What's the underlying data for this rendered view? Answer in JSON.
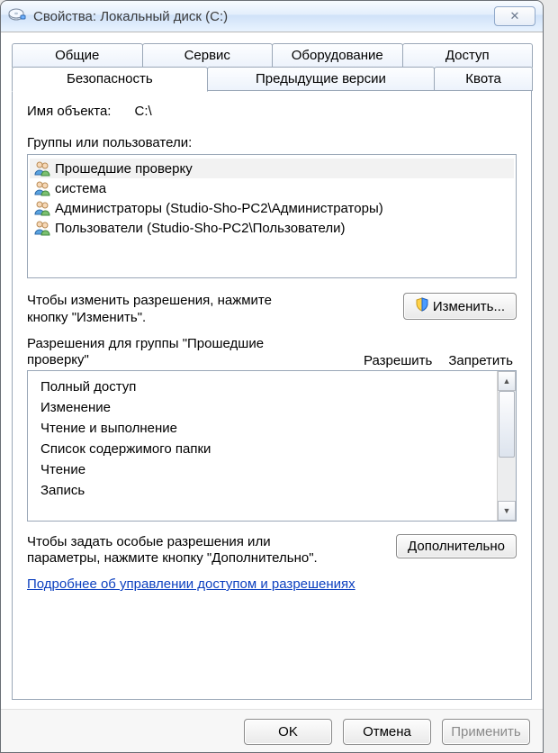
{
  "window": {
    "title": "Свойства: Локальный диск (C:)",
    "close_glyph": "✕"
  },
  "tabs": {
    "row1": [
      {
        "label": "Общие"
      },
      {
        "label": "Сервис"
      },
      {
        "label": "Оборудование"
      },
      {
        "label": "Доступ"
      }
    ],
    "row2": [
      {
        "label": "Безопасность",
        "active": true
      },
      {
        "label": "Предыдущие версии"
      },
      {
        "label": "Квота"
      }
    ]
  },
  "security": {
    "object_name_label": "Имя объекта:",
    "object_name_value": "C:\\",
    "groups_label": "Группы или пользователи:",
    "groups": [
      {
        "label": "Прошедшие проверку",
        "selected": true
      },
      {
        "label": "система"
      },
      {
        "label": "Администраторы (Studio-Sho-PC2\\Администраторы)"
      },
      {
        "label": "Пользователи (Studio-Sho-PC2\\Пользователи)"
      }
    ],
    "edit_hint": "Чтобы изменить разрешения, нажмите кнопку \"Изменить\".",
    "edit_button": "Изменить...",
    "perm_header_left": "Разрешения для группы \"Прошедшие проверку\"",
    "perm_col_allow": "Разрешить",
    "perm_col_deny": "Запретить",
    "permissions": [
      "Полный доступ",
      "Изменение",
      "Чтение и выполнение",
      "Список содержимого папки",
      "Чтение",
      "Запись"
    ],
    "advanced_hint": "Чтобы задать особые разрешения или параметры, нажмите кнопку \"Дополнительно\".",
    "advanced_button": "Дополнительно",
    "learn_more_link": "Подробнее об управлении доступом и разрешениях "
  },
  "buttons": {
    "ok": "OK",
    "cancel": "Отмена",
    "apply": "Применить"
  }
}
